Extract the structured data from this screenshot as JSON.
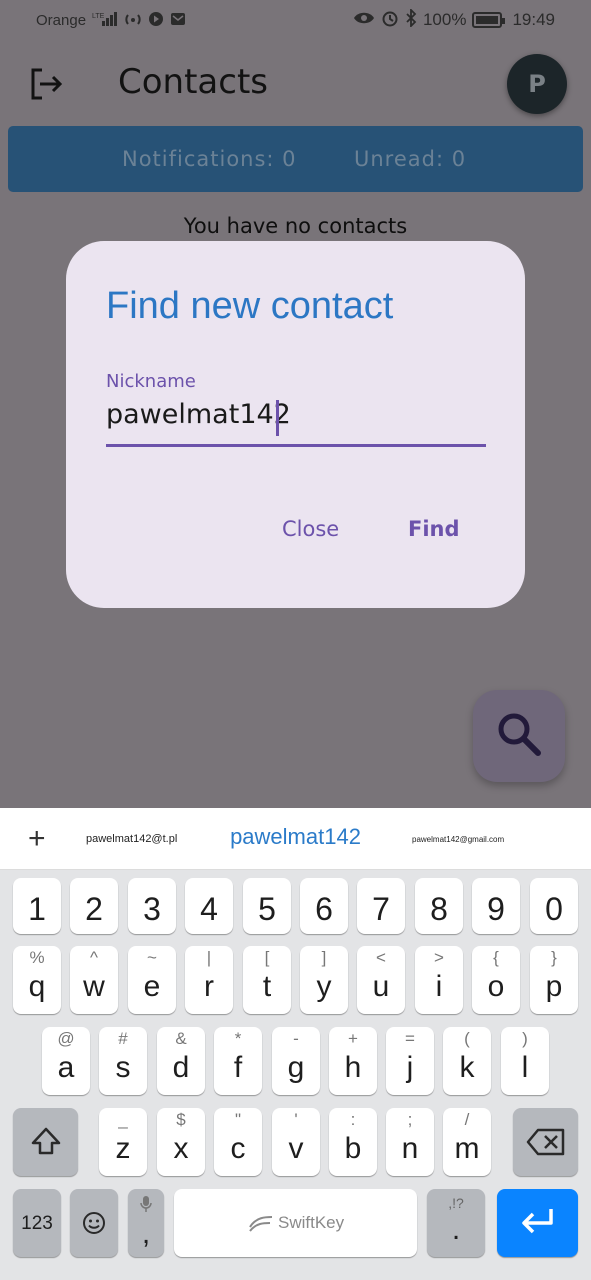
{
  "status_bar": {
    "carrier": "Orange",
    "battery": "100%",
    "time": "19:49"
  },
  "app_bar": {
    "title": "Contacts",
    "avatar_letter": "P"
  },
  "notifications": {
    "notifications_text": "Notifications: 0",
    "unread_text": "Unread: 0"
  },
  "empty_message": "You have no contacts",
  "dialog": {
    "title": "Find new contact",
    "field_label": "Nickname",
    "field_value": "pawelmat142",
    "close_label": "Close",
    "find_label": "Find"
  },
  "keyboard": {
    "suggestions": {
      "plus": "+",
      "left": "pawelmat142@t.pl",
      "middle": "pawelmat142",
      "right": "pawelmat142@gmail.com"
    },
    "row_numbers": [
      "1",
      "2",
      "3",
      "4",
      "5",
      "6",
      "7",
      "8",
      "9",
      "0"
    ],
    "row1": [
      {
        "m": "q",
        "s": "%"
      },
      {
        "m": "w",
        "s": "^"
      },
      {
        "m": "e",
        "s": "~"
      },
      {
        "m": "r",
        "s": "|"
      },
      {
        "m": "t",
        "s": "["
      },
      {
        "m": "y",
        "s": "]"
      },
      {
        "m": "u",
        "s": "<"
      },
      {
        "m": "i",
        "s": ">"
      },
      {
        "m": "o",
        "s": "{"
      },
      {
        "m": "p",
        "s": "}"
      }
    ],
    "row2": [
      {
        "m": "a",
        "s": "@"
      },
      {
        "m": "s",
        "s": "#"
      },
      {
        "m": "d",
        "s": "&"
      },
      {
        "m": "f",
        "s": "*"
      },
      {
        "m": "g",
        "s": "-"
      },
      {
        "m": "h",
        "s": "+"
      },
      {
        "m": "j",
        "s": "="
      },
      {
        "m": "k",
        "s": "("
      },
      {
        "m": "l",
        "s": ")"
      }
    ],
    "row3": [
      {
        "m": "z",
        "s": "_"
      },
      {
        "m": "x",
        "s": "$"
      },
      {
        "m": "c",
        "s": "\""
      },
      {
        "m": "v",
        "s": "'"
      },
      {
        "m": "b",
        "s": ":"
      },
      {
        "m": "n",
        "s": ";"
      },
      {
        "m": "m",
        "s": "/"
      }
    ],
    "numbers_key": "123",
    "comma_key": ",",
    "space_label": "SwiftKey",
    "period_key": ".",
    "period_sub": ",!?"
  },
  "colors": {
    "accent_purple": "#6c52ab",
    "title_blue": "#2c77c4",
    "notif_bar": "#275276",
    "enter_key": "#0a84ff"
  }
}
